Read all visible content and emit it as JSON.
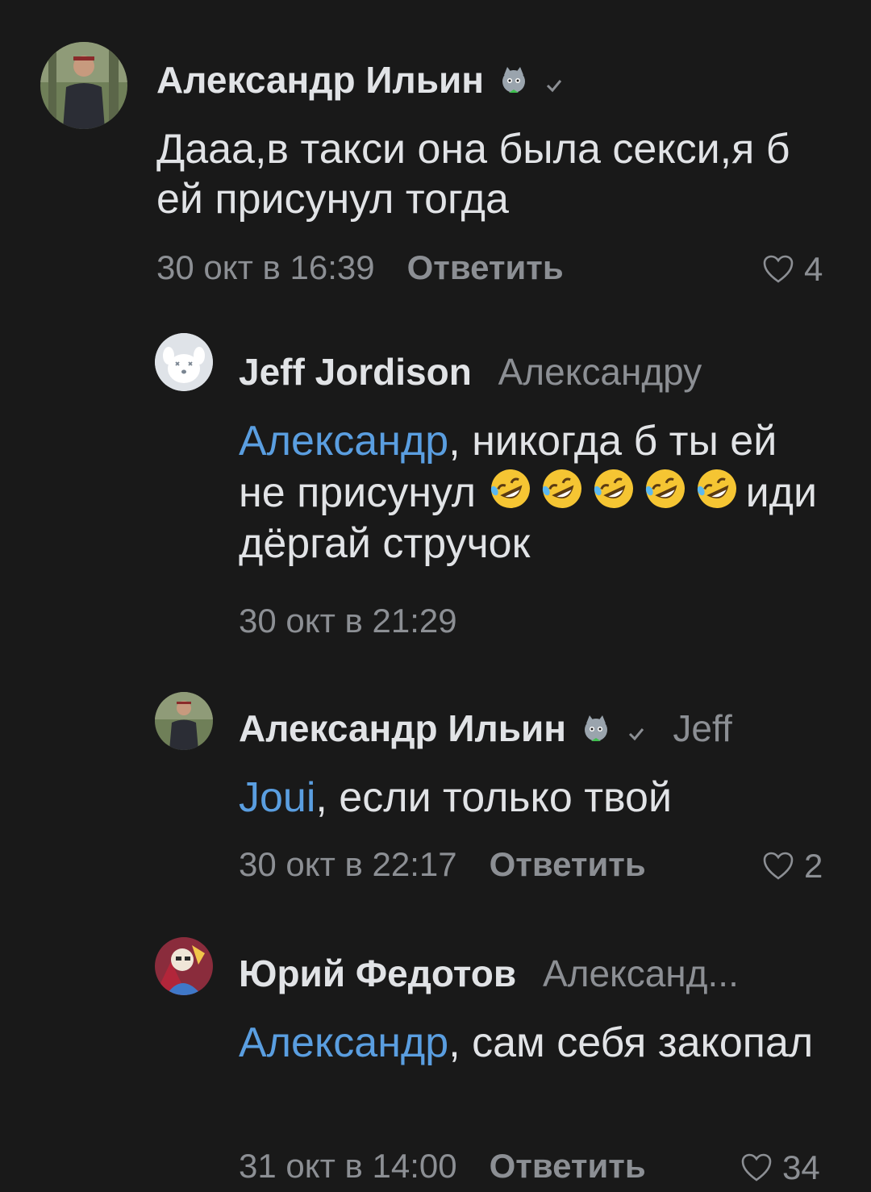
{
  "comments": [
    {
      "author": "Александр Ильин",
      "reply_to": "",
      "text": "Дааа,в такси она была секси,я б ей присунул тогда",
      "time": "30 окт в 16:39",
      "reply_label": "Ответить",
      "likes": "4"
    },
    {
      "author": "Jeff Jordison",
      "reply_to": "Александру",
      "mention": "Александр",
      "text_1": ", никогда б ты ей не присунул",
      "text_2": "иди дёргай стручок",
      "time": "30 окт в 21:29"
    },
    {
      "author": "Александр Ильин",
      "reply_to": "Jeff",
      "mention": "Joui",
      "text": ", если только твой",
      "time": "30 окт в 22:17",
      "reply_label": "Ответить",
      "likes": "2"
    },
    {
      "author": "Юрий Федотов",
      "reply_to": "Александ...",
      "mention": "Александр",
      "text": ", сам себя закопал",
      "time": "31 окт в 14:00",
      "reply_label": "Ответить",
      "likes": "34"
    }
  ],
  "colors": {
    "background": "#191919",
    "text": "#e1e3e6",
    "secondary": "#8c8f94",
    "mention": "#5a9ee0"
  }
}
